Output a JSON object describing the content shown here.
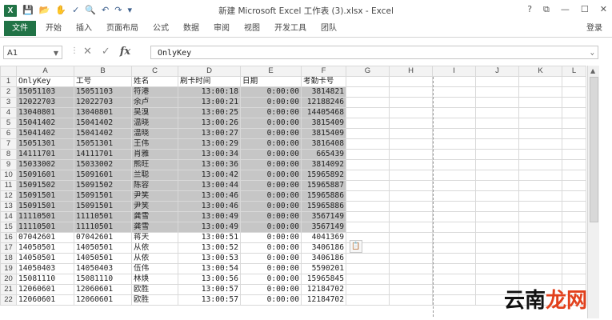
{
  "window": {
    "title": "新建 Microsoft Excel 工作表 (3).xlsx - Excel",
    "app_logo": "X",
    "controls": [
      "?",
      "⧉",
      "—",
      "☐",
      "✕"
    ]
  },
  "ribbon": {
    "file_tab": "文件",
    "tabs": [
      "开始",
      "插入",
      "页面布局",
      "公式",
      "数据",
      "审阅",
      "视图",
      "开发工具",
      "团队"
    ],
    "login": "登录"
  },
  "formula_bar": {
    "name_box": "A1",
    "content": "OnlyKey",
    "fx": "fx"
  },
  "sheet": {
    "columns": [
      "A",
      "B",
      "C",
      "D",
      "E",
      "F",
      "G",
      "H",
      "I",
      "J",
      "K",
      "L"
    ],
    "header_row": [
      "OnlyKey",
      "工号",
      "姓名",
      "刷卡时间",
      "日期",
      "考勤卡号"
    ],
    "rows": [
      [
        "15051103",
        "15051103",
        "符港",
        "13:00:18",
        "0:00:00",
        "3814821"
      ],
      [
        "12022703",
        "12022703",
        "余卢",
        "13:00:21",
        "0:00:00",
        "12188246"
      ],
      [
        "13040801",
        "13040801",
        "吴溴",
        "13:00:25",
        "0:00:00",
        "14405468"
      ],
      [
        "15041402",
        "15041402",
        "温晓",
        "13:00:26",
        "0:00:00",
        "3815409"
      ],
      [
        "15041402",
        "15041402",
        "温晓",
        "13:00:27",
        "0:00:00",
        "3815409"
      ],
      [
        "15051301",
        "15051301",
        "王伟",
        "13:00:29",
        "0:00:00",
        "3816408"
      ],
      [
        "14111701",
        "14111701",
        "肖雅",
        "13:00:34",
        "0:00:00",
        "665439"
      ],
      [
        "15033002",
        "15033002",
        "熊旺",
        "13:00:36",
        "0:00:00",
        "3814092"
      ],
      [
        "15091601",
        "15091601",
        "兰聪",
        "13:00:42",
        "0:00:00",
        "15965892"
      ],
      [
        "15091502",
        "15091502",
        "陈容",
        "13:00:44",
        "0:00:00",
        "15965887"
      ],
      [
        "15091501",
        "15091501",
        "尹笑",
        "13:00:46",
        "0:00:00",
        "15965886"
      ],
      [
        "15091501",
        "15091501",
        "尹笑",
        "13:00:46",
        "0:00:00",
        "15965886"
      ],
      [
        "11110501",
        "11110501",
        "龚雪",
        "13:00:49",
        "0:00:00",
        "3567149"
      ],
      [
        "11110501",
        "11110501",
        "龚雪",
        "13:00:49",
        "0:00:00",
        "3567149"
      ],
      [
        "07042601",
        "07042601",
        "蒋天",
        "13:00:51",
        "0:00:00",
        "4041369"
      ],
      [
        "14050501",
        "14050501",
        "从依",
        "13:00:52",
        "0:00:00",
        "3406186"
      ],
      [
        "14050501",
        "14050501",
        "从依",
        "13:00:53",
        "0:00:00",
        "3406186"
      ],
      [
        "14050403",
        "14050403",
        "伍伟",
        "13:00:54",
        "0:00:00",
        "5590201"
      ],
      [
        "15081110",
        "15081110",
        "林焕",
        "13:00:56",
        "0:00:00",
        "15965845"
      ],
      [
        "12060601",
        "12060601",
        "欧胜",
        "13:00:57",
        "0:00:00",
        "12184702"
      ],
      [
        "12060601",
        "12060601",
        "欧胜",
        "13:00:57",
        "0:00:00",
        "12184702"
      ]
    ]
  },
  "watermark": {
    "main": "云南",
    "accent": "龙网"
  },
  "colors": {
    "accent": "#217346",
    "selection": "#c6c6c6"
  }
}
